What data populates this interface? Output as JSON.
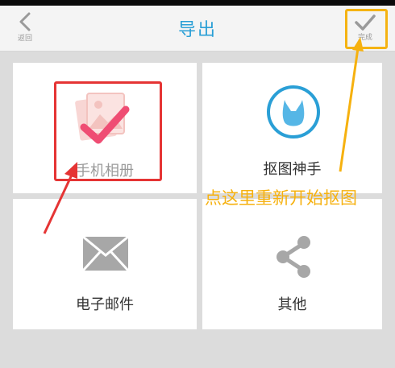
{
  "header": {
    "back_label": "返回",
    "title": "导出",
    "done_label": "完成"
  },
  "tiles": [
    {
      "label": "手机相册",
      "icon": "photo-album-check-icon"
    },
    {
      "label": "抠图神手",
      "icon": "rabbit-logo-icon"
    },
    {
      "label": "电子邮件",
      "icon": "envelope-icon"
    },
    {
      "label": "其他",
      "icon": "share-icon"
    }
  ],
  "annotation": {
    "text": "点这里重新开始抠图",
    "color": "#f6b10f"
  },
  "colors": {
    "accent": "#2a9fd6",
    "highlight_red": "#e53434",
    "highlight_yellow": "#f5b312"
  }
}
